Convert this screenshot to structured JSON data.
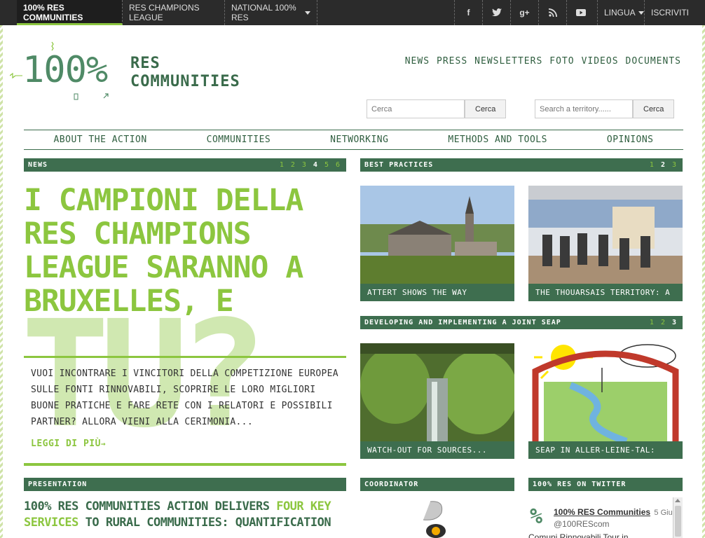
{
  "topbar": {
    "nav": [
      {
        "label": "100% RES COMMUNITIES",
        "active": true
      },
      {
        "label": "RES CHAMPIONS LEAGUE"
      },
      {
        "label": "NATIONAL 100% RES"
      }
    ],
    "lingua": "LINGUA",
    "iscriviti": "ISCRIVITI"
  },
  "logo": {
    "percent": "100%",
    "line1": "RES",
    "line2": "COMMUNITIES"
  },
  "header_nav": [
    "NEWS",
    "PRESS",
    "NEWSLETTERS",
    "FOTO",
    "VIDEOS",
    "DOCUMENTS"
  ],
  "search1": {
    "placeholder": "Cerca",
    "button": "Cerca"
  },
  "search2": {
    "placeholder": "Search a territory......",
    "button": "Cerca"
  },
  "main_nav": [
    "ABOUT THE ACTION",
    "COMMUNITIES",
    "NETWORKING",
    "METHODS AND TOOLS",
    "OPINIONS"
  ],
  "news": {
    "label": "NEWS",
    "pages": [
      "1",
      "2",
      "3",
      "4",
      "5",
      "6"
    ],
    "title": "I CAMPIONI DELLA RES CHAMPIONS LEAGUE SARANNO A BRUXELLES, E",
    "big": "TU?",
    "text": "VUOI INCONTRARE I VINCITORI DELLA COMPETIZIONE EUROPEA SULLE FONTI RINNOVABILI, SCOPRIRE LE LORO MIGLIORI BUONE PRATICHE E FARE RETE CON I RELATORI E POSSIBILI PARTNER? ALLORA VIENI ALLA CERIMONIA...",
    "readmore": "LEGGI DI PIÙ"
  },
  "best_practices": {
    "label": "BEST PRACTICES",
    "pages": [
      "1",
      "2",
      "3"
    ],
    "cards": [
      "ATTERT SHOWS THE WAY",
      "THE THOUARSAIS TERRITORY: A"
    ]
  },
  "seap": {
    "label": "DEVELOPING AND IMPLEMENTING A JOINT SEAP",
    "pages": [
      "1",
      "2",
      "3"
    ],
    "cards": [
      "WATCH-OUT FOR SOURCES...",
      "SEAP IN ALLER-LEINE-TAL:"
    ]
  },
  "presentation": {
    "label": "PRESENTATION",
    "part1": "100% RES COMMUNITIES ACTION DELIVERS ",
    "highlight": "FOUR KEY SERVICES",
    "part2": " TO RURAL COMMUNITIES: QUANTIFICATION"
  },
  "coordinator": {
    "label": "COORDINATOR"
  },
  "twitter": {
    "label": "100% RES ON TWITTER",
    "account": "100% RES Communities",
    "date": "5 Giu",
    "handle": "@100REScom",
    "tweet": "Comuni Rinnovabili Tour in"
  }
}
